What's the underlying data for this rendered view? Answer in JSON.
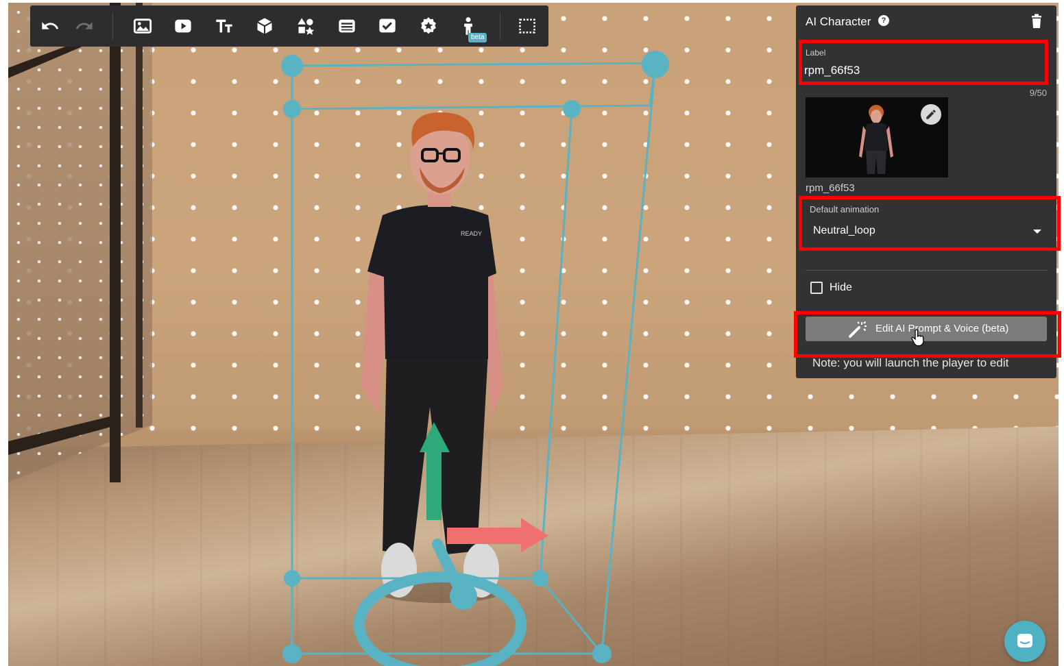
{
  "toolbar": {
    "buttons": [
      {
        "name": "undo-button",
        "icon": "undo-icon"
      },
      {
        "name": "redo-button",
        "icon": "redo-icon"
      },
      {
        "name": "add-image-button",
        "icon": "image-icon"
      },
      {
        "name": "add-video-button",
        "icon": "video-icon"
      },
      {
        "name": "add-text-button",
        "icon": "text-icon"
      },
      {
        "name": "add-3d-model-button",
        "icon": "cube-icon"
      },
      {
        "name": "add-shapes-button",
        "icon": "shapes-icon"
      },
      {
        "name": "add-banner-button",
        "icon": "panel-icon"
      },
      {
        "name": "add-quiz-button",
        "icon": "checkbox-icon"
      },
      {
        "name": "add-badge-button",
        "icon": "star-badge-icon"
      },
      {
        "name": "add-ai-character-button",
        "icon": "person-icon"
      },
      {
        "name": "select-area-button",
        "icon": "marquee-icon"
      }
    ],
    "beta_badge": "beta"
  },
  "panel": {
    "title": "AI Character",
    "help_icon": "?",
    "label_caption": "Label",
    "label_value": "rpm_66f53",
    "char_count": "9/50",
    "thumbnail_caption": "rpm_66f53",
    "default_animation_caption": "Default animation",
    "default_animation_value": "Neutral_loop",
    "hide_label": "Hide",
    "hide_checked": false,
    "edit_button_label": "Edit AI Prompt & Voice (beta)",
    "note": "Note: you will launch the player to edit"
  },
  "colors": {
    "panel_bg": "#323234",
    "toolbar_bg": "#2d2d2f",
    "gizmo": "#5ab3c2",
    "y_axis_arrow": "#2ea97a",
    "x_axis_arrow": "#f07070",
    "highlight": "#ff0000",
    "chat": "#4fb2c4"
  }
}
